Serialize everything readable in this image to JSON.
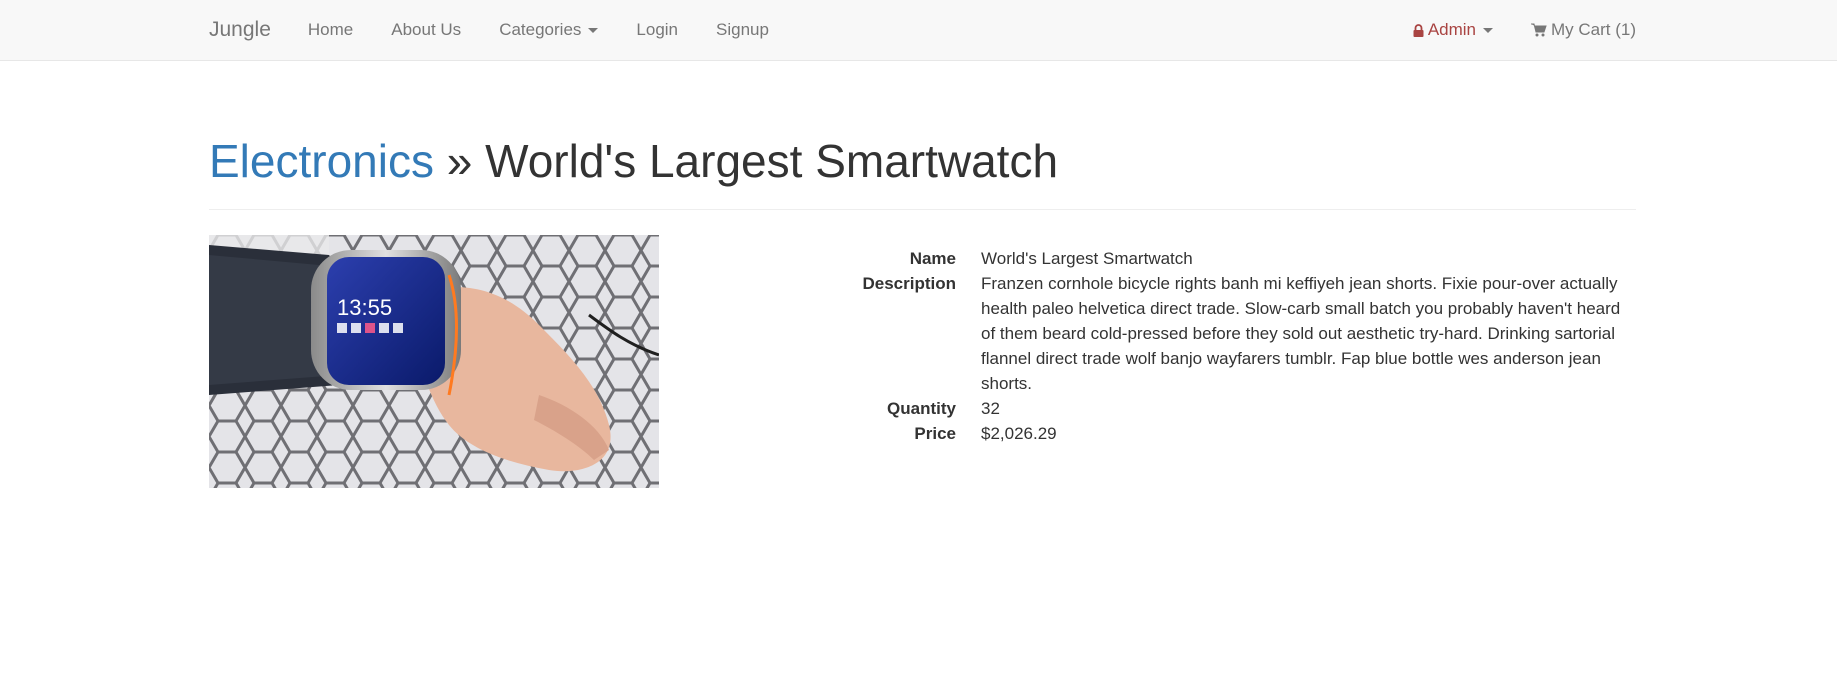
{
  "nav": {
    "brand": "Jungle",
    "links": {
      "home": "Home",
      "about": "About Us",
      "categories": "Categories",
      "login": "Login",
      "signup": "Signup"
    },
    "admin": "Admin",
    "cart": "My Cart (1)"
  },
  "header": {
    "category": "Electronics",
    "separator": "»",
    "title": "World's Largest Smartwatch"
  },
  "product": {
    "image_alt": "World's Largest Smartwatch",
    "labels": {
      "name": "Name",
      "description": "Description",
      "quantity": "Quantity",
      "price": "Price"
    },
    "name": "World's Largest Smartwatch",
    "description": "Franzen cornhole bicycle rights banh mi keffiyeh jean shorts. Fixie pour-over actually health paleo helvetica direct trade. Slow-carb small batch you probably haven't heard of them beard cold-pressed before they sold out aesthetic try-hard. Drinking sartorial flannel direct trade wolf banjo wayfarers tumblr. Fap blue bottle wes anderson jean shorts.",
    "quantity": "32",
    "price": "$2,026.29",
    "watch_time": "13:55"
  },
  "colors": {
    "link": "#337ab7",
    "admin": "#a94442",
    "nav_bg": "#f8f8f8",
    "nav_text": "#777777"
  }
}
